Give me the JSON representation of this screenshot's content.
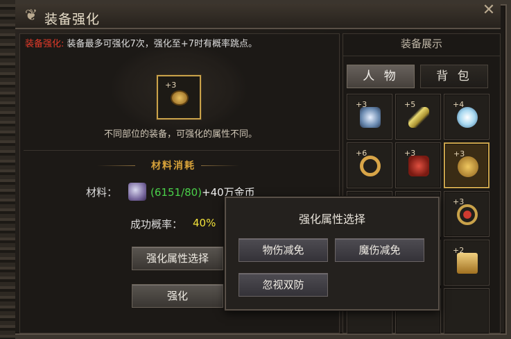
{
  "window": {
    "title": "装备强化",
    "close_glyph": "✕"
  },
  "main": {
    "desc_label": "装备强化:",
    "desc_text": "装备最多可强化7次，强化至+7时有概率跳点。",
    "item_level": "+3",
    "note": "不同部位的装备，可强化的属性不同。",
    "materials_title": "材料消耗",
    "materials_label": "材料：",
    "materials_count": "(6151/80)",
    "materials_gold": "+40万金币",
    "success_label": "成功概率：",
    "success_value": "40%",
    "select_button": "强化属性选择",
    "enhance_button": "强化"
  },
  "right": {
    "title": "装备展示",
    "tabs": [
      "人 物",
      "背 包"
    ],
    "slots": [
      {
        "level": "+3",
        "icon": "weapon-icon",
        "color": "#b0c8e6"
      },
      {
        "level": "+5",
        "icon": "dagger-icon",
        "color": "#e8d870"
      },
      {
        "level": "+4",
        "icon": "orb-icon",
        "color": "#a8d8f0"
      },
      {
        "level": "+6",
        "icon": "ring-icon",
        "color": "#d8a548"
      },
      {
        "level": "+3",
        "icon": "helmet-icon",
        "color": "#c04030"
      },
      {
        "level": "+3",
        "icon": "ring-icon",
        "color": "#e2b24a"
      },
      {
        "level": "+3",
        "icon": "ring-icon",
        "color": "#c23a30"
      },
      {
        "level": "+2",
        "icon": "book-icon",
        "color": "#d6a640"
      }
    ]
  },
  "popup": {
    "title": "强化属性选择",
    "options": [
      "物伤减免",
      "魔伤减免",
      "忽视双防"
    ]
  }
}
